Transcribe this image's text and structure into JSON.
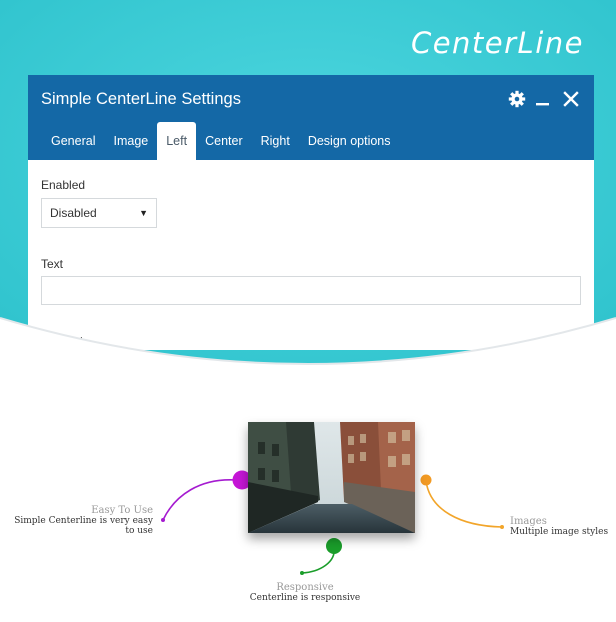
{
  "brand": {
    "name": "CenterLine"
  },
  "colors": {
    "teal": "#39ccd6",
    "header": "#1468a6",
    "magenta": "#c516d6",
    "orange": "#f29a23",
    "green": "#1a9d2a"
  },
  "dialog": {
    "title": "Simple CenterLine Settings",
    "icons": [
      "gear-icon",
      "minimize-icon",
      "close-icon"
    ],
    "tabs": [
      {
        "label": "General",
        "active": false
      },
      {
        "label": "Image",
        "active": false
      },
      {
        "label": "Left",
        "active": true
      },
      {
        "label": "Center",
        "active": false
      },
      {
        "label": "Right",
        "active": false
      },
      {
        "label": "Design options",
        "active": false
      }
    ],
    "fields": {
      "enabled_label": "Enabled",
      "enabled_value": "Disabled",
      "text_label": "Text",
      "text_value": "",
      "content_label": "Content"
    }
  },
  "features": {
    "easy": {
      "title": "Easy To Use",
      "desc": "Simple Centerline is very easy to use"
    },
    "images": {
      "title": "Images",
      "desc": "Multiple image styles"
    },
    "responsive": {
      "title": "Responsive",
      "desc": "Centerline is responsive"
    }
  }
}
